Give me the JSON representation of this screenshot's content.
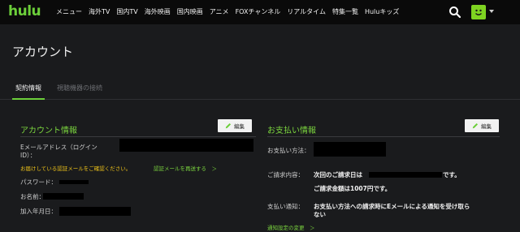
{
  "brand": {
    "logo": "hulu",
    "accent_color": "#6ccf3a"
  },
  "nav": {
    "items": [
      "メニュー",
      "海外TV",
      "国内TV",
      "海外映画",
      "国内映画",
      "アニメ",
      "FOXチャンネル",
      "リアルタイム",
      "特集一覧",
      "Huluキッズ"
    ]
  },
  "page": {
    "title": "アカウント"
  },
  "tabs": [
    {
      "label": "契約情報",
      "active": true
    },
    {
      "label": "視聴機器の接続",
      "active": false
    }
  ],
  "account": {
    "title": "アカウント情報",
    "edit_label": "編集",
    "email_label": "Eメールアドレス（ログイン ID）：",
    "verify_warning": "お届けしている認証メールをご確認ください。",
    "resend_link": "認証メールを再送する　＞",
    "password_label": "パスワード：",
    "name_label": "お名前：",
    "joined_label": "加入年月日："
  },
  "payment": {
    "title": "お支払い情報",
    "edit_label": "編集",
    "method_label": "お支払い方法：",
    "billing_label": "ご請求内容：",
    "billing_line1_prefix": "次回のご請求日は",
    "billing_line1_suffix": "です。",
    "billing_line2": "ご請求金額は1007円です。",
    "notice_label": "支払い通知：",
    "notice_line1": "お支払い方法への請求時にEメールによる通知を受け取ら",
    "notice_line2": "ない",
    "notice_settings_link": "通知設定の変更　＞"
  },
  "icons": {
    "search": "search-icon",
    "avatar": "profile-avatar-icon",
    "edit": "pencil-icon"
  }
}
